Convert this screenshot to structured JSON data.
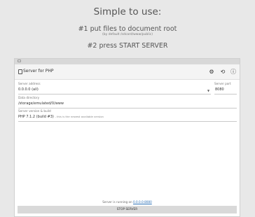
{
  "promo": {
    "headline": "Simple to use:",
    "step1": "#1 put files to document root",
    "step1_sub": "(by default /sdcard/www/public)",
    "step2": "#2 press START SERVER"
  },
  "app": {
    "title": "Server for PHP",
    "icons": {
      "app": "file-icon",
      "settings": "gear-icon",
      "history": "history-icon",
      "help": "help-icon"
    }
  },
  "form": {
    "server_address_label": "Server address",
    "server_address_value": "0.0.0.0 (all)",
    "server_port_label": "Server port",
    "server_port_value": "8080",
    "data_directory_label": "Data directory",
    "data_directory_value": "/storage/emulated/0/www",
    "server_version_label": "Server version & build",
    "server_version_value": "PHP 7.1.2 (build #3)",
    "server_version_hint": "- this is the newest available version"
  },
  "status": {
    "running_text": "Server is running on",
    "running_link": "0.0.0.0:8080"
  },
  "actions": {
    "stop_server": "STOP SERVER"
  },
  "colors": {
    "background": "#e8e8e8",
    "link": "#2a6fb5",
    "button": "#d9d9d9"
  }
}
